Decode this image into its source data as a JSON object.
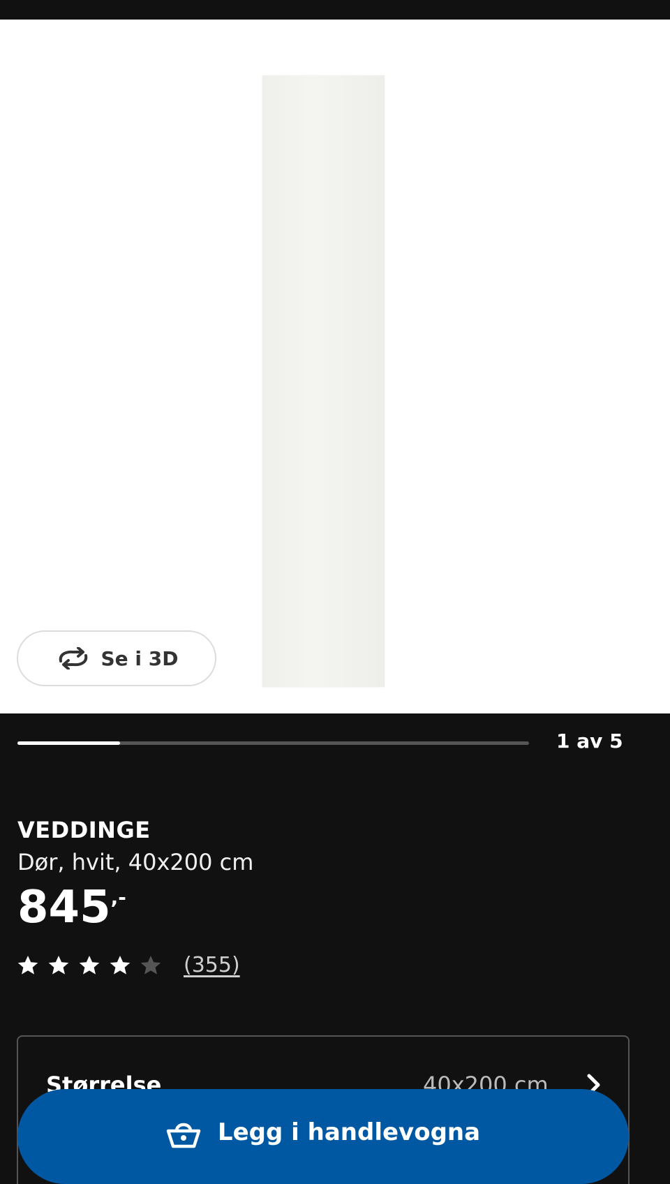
{
  "gallery": {
    "view_3d_label": "Se i 3D",
    "progress": 0.2,
    "counter": "1 av 5"
  },
  "product": {
    "name": "VEDDINGE",
    "description": "Dør, hvit, 40x200 cm",
    "price": "845",
    "price_suffix": ",-",
    "rating": 4,
    "rating_max": 5,
    "review_count": "(355)"
  },
  "size": {
    "label": "Størrelse",
    "value": "40x200 cm"
  },
  "cart": {
    "label": "Legg i handlevogna"
  },
  "colors": {
    "background": "#111111",
    "accent_blue": "#0058a3",
    "star_filled": "#ffffff",
    "star_empty": "#555555"
  }
}
